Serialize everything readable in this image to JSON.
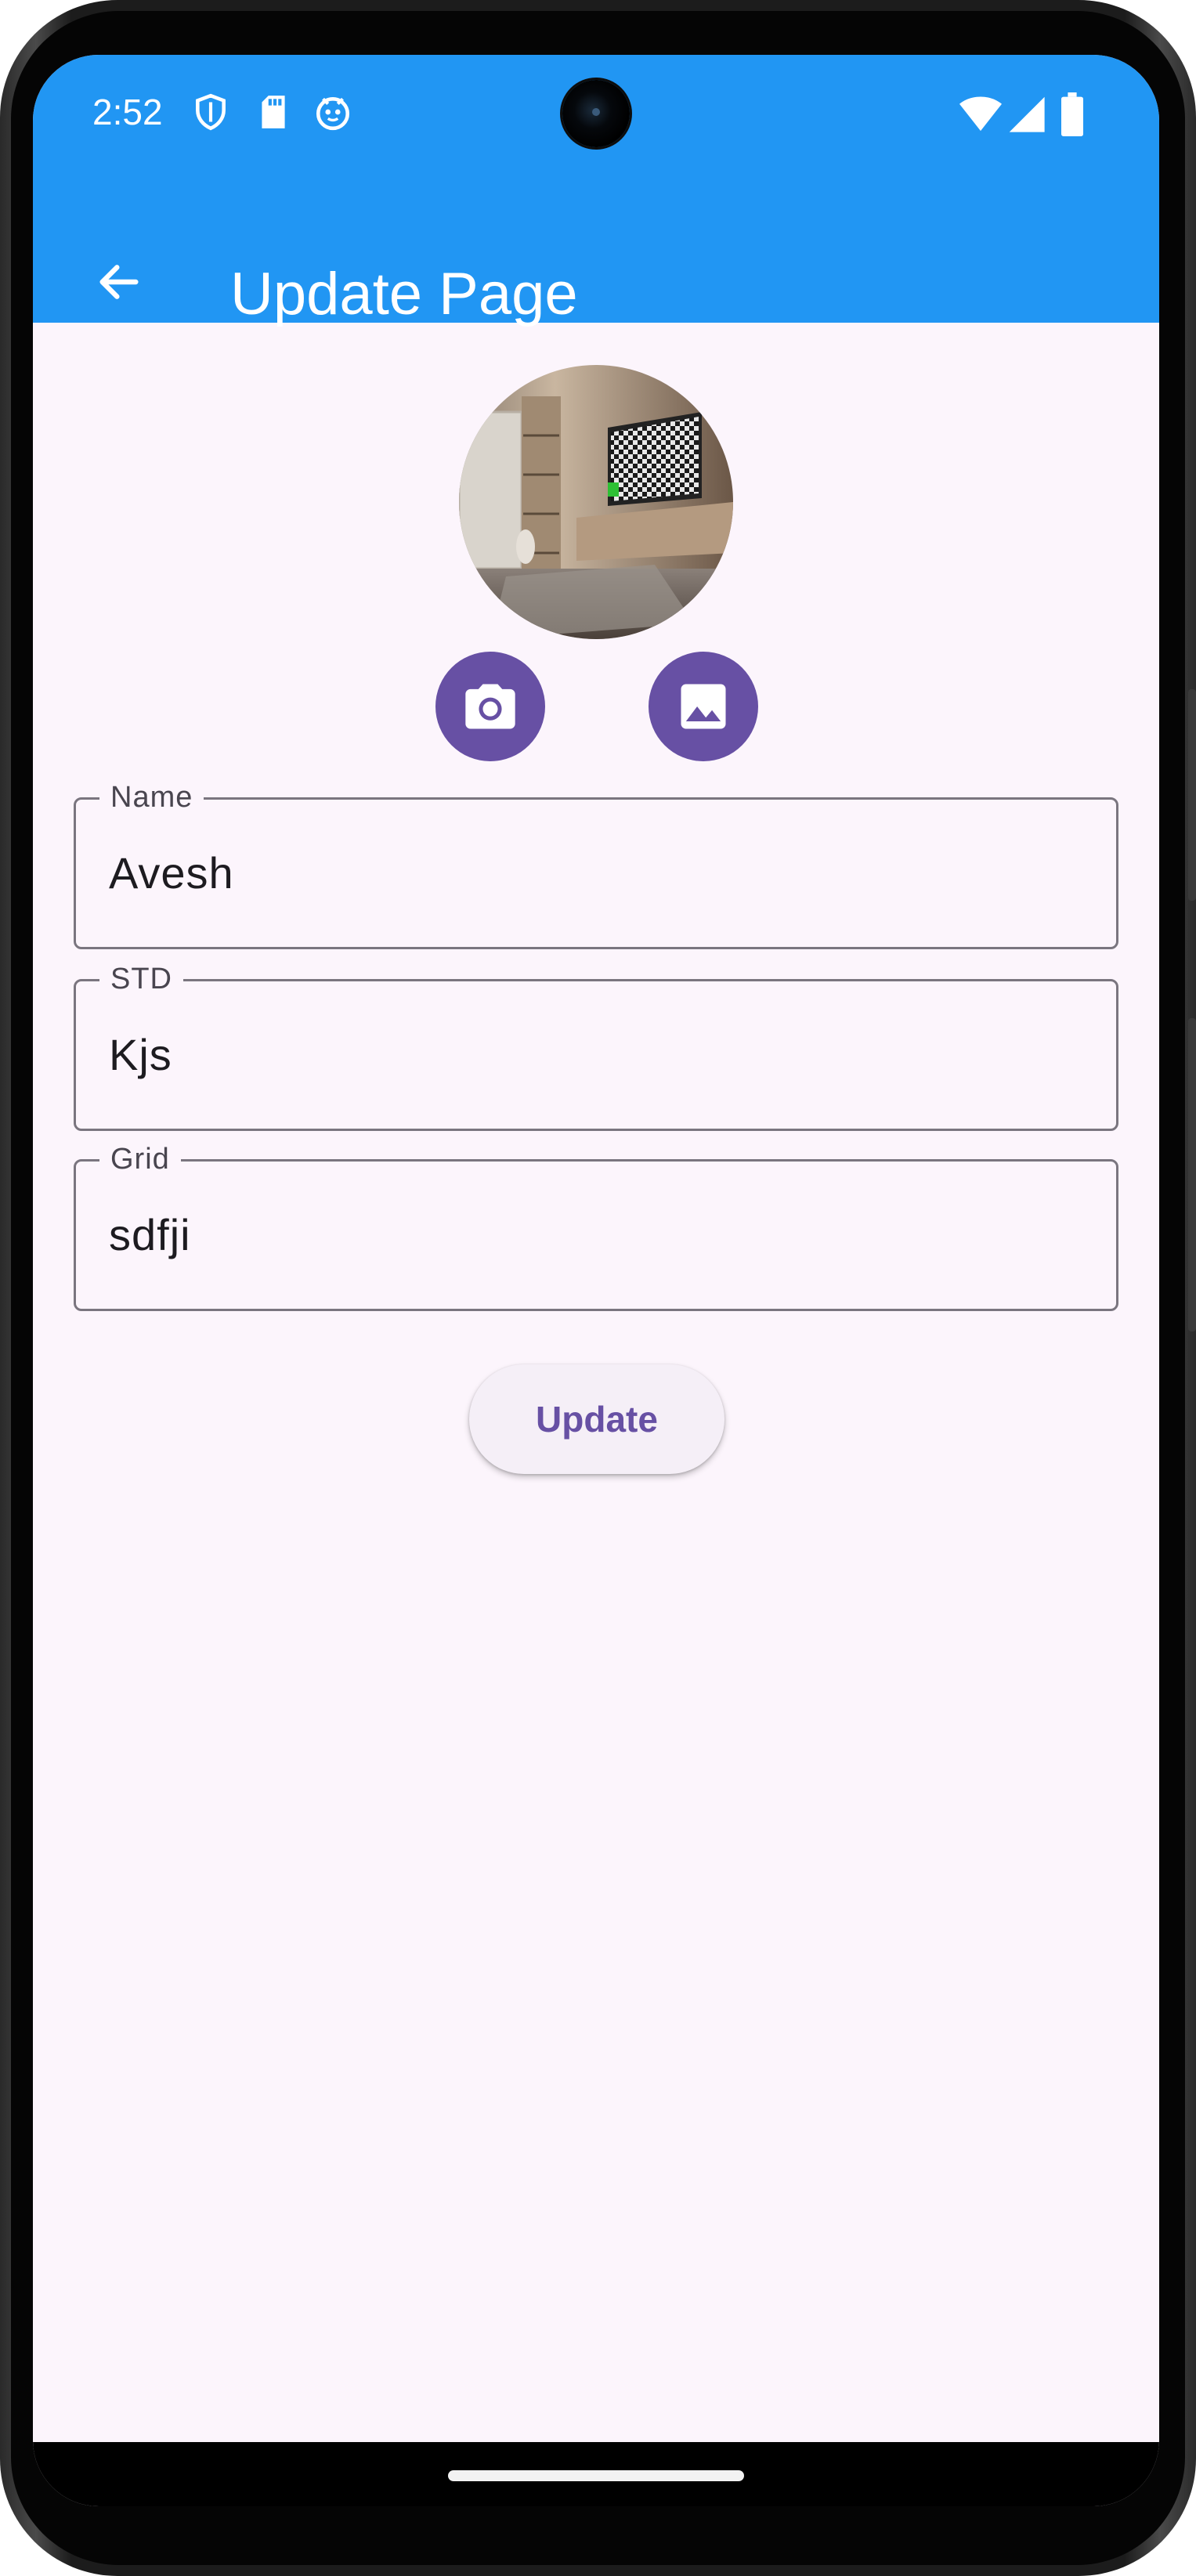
{
  "status_bar": {
    "time": "2:52",
    "icons_left": [
      "shield-icon",
      "sd-card-icon",
      "app-notification-icon"
    ],
    "icons_right": [
      "wifi-icon",
      "cell-signal-icon",
      "battery-icon"
    ]
  },
  "app_bar": {
    "title": "Update Page",
    "back_icon": "arrow-back-icon",
    "color": "#2196f3"
  },
  "profile": {
    "image_description_icon": "profile-photo",
    "camera_icon": "camera-icon",
    "gallery_icon": "gallery-icon",
    "button_color": "#6750a4"
  },
  "form": {
    "fields": [
      {
        "label": "Name",
        "value": "Avesh"
      },
      {
        "label": "STD",
        "value": "Kjs"
      },
      {
        "label": "Grid",
        "value": "sdfji"
      }
    ],
    "submit_label": "Update"
  },
  "colors": {
    "background": "#fcf5fc",
    "accent": "#6750a4",
    "outline": "#7a757f"
  }
}
